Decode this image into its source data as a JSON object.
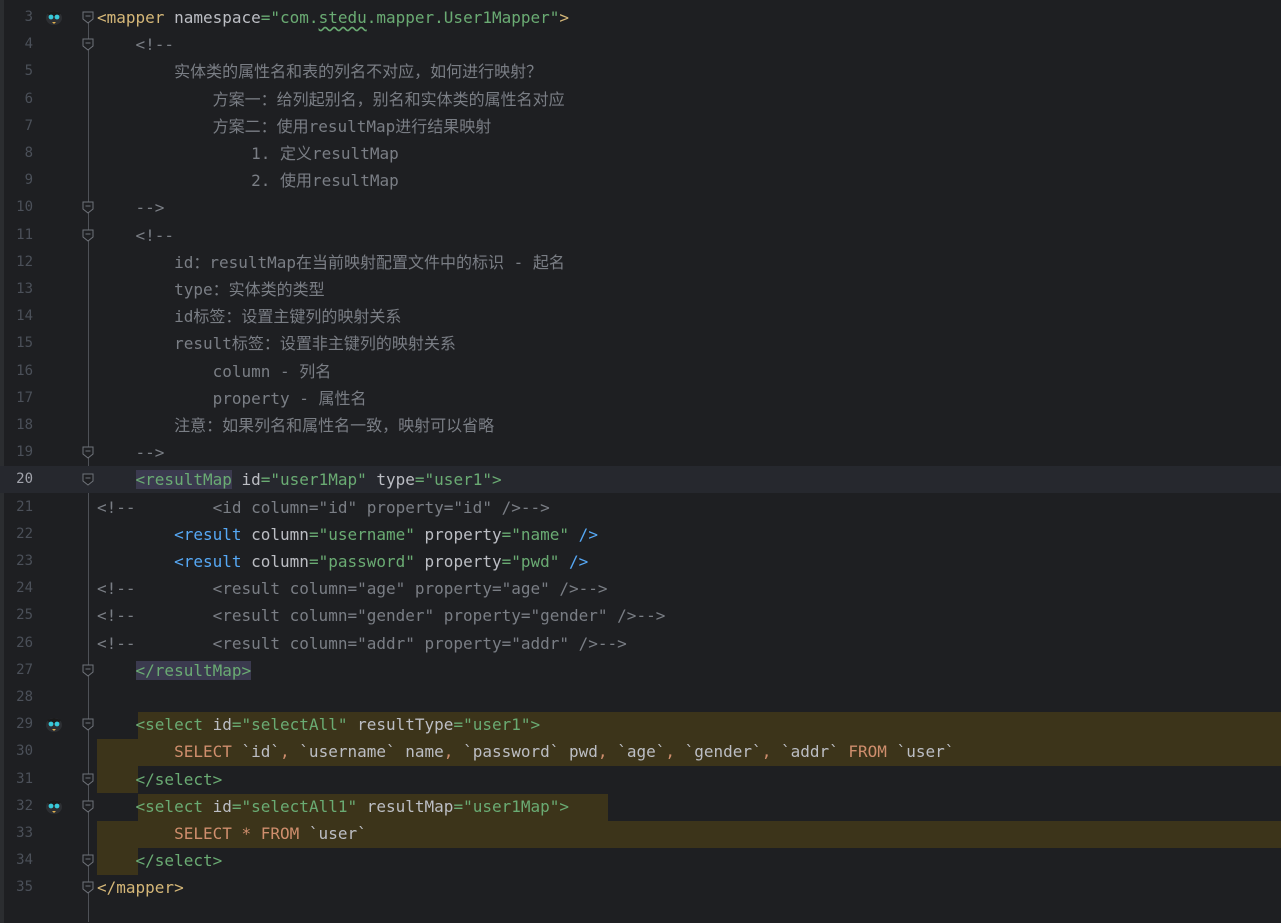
{
  "editor": {
    "lines": [
      {
        "num": "3",
        "tokens": [
          {
            "c": "tag",
            "t": "<mapper "
          },
          {
            "c": "attr",
            "t": "namespace"
          },
          {
            "c": "str",
            "t": "=\"com."
          },
          {
            "c": "str squiggle",
            "t": "stedu"
          },
          {
            "c": "str",
            "t": ".mapper.User1Mapper\""
          },
          {
            "c": "tag",
            "t": ">"
          }
        ]
      },
      {
        "num": "4",
        "tokens": [
          {
            "c": "cmt",
            "t": "    <!--"
          }
        ]
      },
      {
        "num": "5",
        "tokens": [
          {
            "c": "cmt",
            "t": "        实体类的属性名和表的列名不对应，如何进行映射？"
          }
        ]
      },
      {
        "num": "6",
        "tokens": [
          {
            "c": "cmt",
            "t": "            方案一：给列起别名，别名和实体类的属性名对应"
          }
        ]
      },
      {
        "num": "7",
        "tokens": [
          {
            "c": "cmt",
            "t": "            方案二：使用resultMap进行结果映射"
          }
        ]
      },
      {
        "num": "8",
        "tokens": [
          {
            "c": "cmt",
            "t": "                1. 定义resultMap"
          }
        ]
      },
      {
        "num": "9",
        "tokens": [
          {
            "c": "cmt",
            "t": "                2. 使用resultMap"
          }
        ]
      },
      {
        "num": "10",
        "tokens": [
          {
            "c": "cmt",
            "t": "    -->"
          }
        ]
      },
      {
        "num": "11",
        "tokens": [
          {
            "c": "cmt",
            "t": "    <!--"
          }
        ]
      },
      {
        "num": "12",
        "tokens": [
          {
            "c": "cmt",
            "t": "        id：resultMap在当前映射配置文件中的标识 - 起名"
          }
        ]
      },
      {
        "num": "13",
        "tokens": [
          {
            "c": "cmt",
            "t": "        type：实体类的类型"
          }
        ]
      },
      {
        "num": "14",
        "tokens": [
          {
            "c": "cmt",
            "t": "        id标签：设置主键列的映射关系"
          }
        ]
      },
      {
        "num": "15",
        "tokens": [
          {
            "c": "cmt",
            "t": "        result标签：设置非主键列的映射关系"
          }
        ]
      },
      {
        "num": "16",
        "tokens": [
          {
            "c": "cmt",
            "t": "            column - 列名"
          }
        ]
      },
      {
        "num": "17",
        "tokens": [
          {
            "c": "cmt",
            "t": "            property - 属性名"
          }
        ]
      },
      {
        "num": "18",
        "tokens": [
          {
            "c": "cmt",
            "t": "        注意：如果列名和属性名一致，映射可以省略"
          }
        ]
      },
      {
        "num": "19",
        "tokens": [
          {
            "c": "cmt",
            "t": "    -->"
          }
        ]
      },
      {
        "num": "20",
        "tokens": [
          {
            "c": "plain",
            "t": "    "
          },
          {
            "c": "hl-tag",
            "t": "<resultMap"
          },
          {
            "c": "attr",
            "t": " id"
          },
          {
            "c": "str",
            "t": "=\"user1Map\""
          },
          {
            "c": "attr",
            "t": " type"
          },
          {
            "c": "str",
            "t": "=\"user1\""
          },
          {
            "c": "rm-tag",
            "t": ">"
          }
        ]
      },
      {
        "num": "21",
        "tokens": [
          {
            "c": "cmt",
            "t": "<!--        <id column=\"id\" property=\"id\" />-->"
          }
        ]
      },
      {
        "num": "22",
        "tokens": [
          {
            "c": "plain",
            "t": "        "
          },
          {
            "c": "tag-blue",
            "t": "<result"
          },
          {
            "c": "attr",
            "t": " column"
          },
          {
            "c": "str",
            "t": "=\"username\""
          },
          {
            "c": "attr",
            "t": " property"
          },
          {
            "c": "str",
            "t": "=\"name\""
          },
          {
            "c": "tag-blue",
            "t": " />"
          }
        ]
      },
      {
        "num": "23",
        "tokens": [
          {
            "c": "plain",
            "t": "        "
          },
          {
            "c": "tag-blue",
            "t": "<result"
          },
          {
            "c": "attr",
            "t": " column"
          },
          {
            "c": "str",
            "t": "=\"password\""
          },
          {
            "c": "attr",
            "t": " property"
          },
          {
            "c": "str",
            "t": "=\"pwd\""
          },
          {
            "c": "tag-blue",
            "t": " />"
          }
        ]
      },
      {
        "num": "24",
        "tokens": [
          {
            "c": "cmt",
            "t": "<!--        <result column=\"age\" property=\"age\" />-->"
          }
        ]
      },
      {
        "num": "25",
        "tokens": [
          {
            "c": "cmt",
            "t": "<!--        <result column=\"gender\" property=\"gender\" />-->"
          }
        ]
      },
      {
        "num": "26",
        "tokens": [
          {
            "c": "cmt",
            "t": "<!--        <result column=\"addr\" property=\"addr\" />-->"
          }
        ]
      },
      {
        "num": "27",
        "tokens": [
          {
            "c": "plain",
            "t": "    "
          },
          {
            "c": "hl-tag",
            "t": "</resultMap>"
          }
        ]
      },
      {
        "num": "28",
        "tokens": []
      },
      {
        "num": "29",
        "tokens": [
          {
            "c": "plain",
            "t": "    "
          },
          {
            "c": "rm-tag",
            "t": "<select"
          },
          {
            "c": "attr",
            "t": " id"
          },
          {
            "c": "str",
            "t": "=\"selectAll\""
          },
          {
            "c": "attr",
            "t": " resultType"
          },
          {
            "c": "str",
            "t": "=\"user1\""
          },
          {
            "c": "rm-tag",
            "t": ">"
          }
        ]
      },
      {
        "num": "30",
        "tokens": [
          {
            "c": "plain",
            "t": "        "
          },
          {
            "c": "kw",
            "t": "SELECT "
          },
          {
            "c": "plain",
            "t": "`id`"
          },
          {
            "c": "kw",
            "t": ", "
          },
          {
            "c": "plain",
            "t": "`username` name"
          },
          {
            "c": "kw",
            "t": ", "
          },
          {
            "c": "plain",
            "t": "`password` pwd"
          },
          {
            "c": "kw",
            "t": ", "
          },
          {
            "c": "plain",
            "t": "`age`"
          },
          {
            "c": "kw",
            "t": ", "
          },
          {
            "c": "plain",
            "t": "`gender`"
          },
          {
            "c": "kw",
            "t": ", "
          },
          {
            "c": "plain",
            "t": "`addr` "
          },
          {
            "c": "kw",
            "t": "FROM "
          },
          {
            "c": "plain",
            "t": "`user`"
          }
        ]
      },
      {
        "num": "31",
        "tokens": [
          {
            "c": "plain",
            "t": "    "
          },
          {
            "c": "rm-tag",
            "t": "</select>"
          }
        ]
      },
      {
        "num": "32",
        "tokens": [
          {
            "c": "plain",
            "t": "    "
          },
          {
            "c": "rm-tag",
            "t": "<select"
          },
          {
            "c": "attr",
            "t": " id"
          },
          {
            "c": "str",
            "t": "=\"selectAll1\""
          },
          {
            "c": "attr",
            "t": " resultMap"
          },
          {
            "c": "str",
            "t": "=\"user1Map\""
          },
          {
            "c": "rm-tag",
            "t": ">"
          }
        ]
      },
      {
        "num": "33",
        "tokens": [
          {
            "c": "plain",
            "t": "        "
          },
          {
            "c": "kw",
            "t": "SELECT * FROM "
          },
          {
            "c": "plain",
            "t": "`user`"
          }
        ]
      },
      {
        "num": "34",
        "tokens": [
          {
            "c": "plain",
            "t": "    "
          },
          {
            "c": "rm-tag",
            "t": "</select>"
          }
        ]
      },
      {
        "num": "35",
        "tokens": [
          {
            "c": "tag",
            "t": "</mapper>"
          }
        ]
      }
    ]
  },
  "icons": {
    "gutter_icon": "mybatis-bird-icon",
    "fold_icon": "fold-marker-icon"
  }
}
